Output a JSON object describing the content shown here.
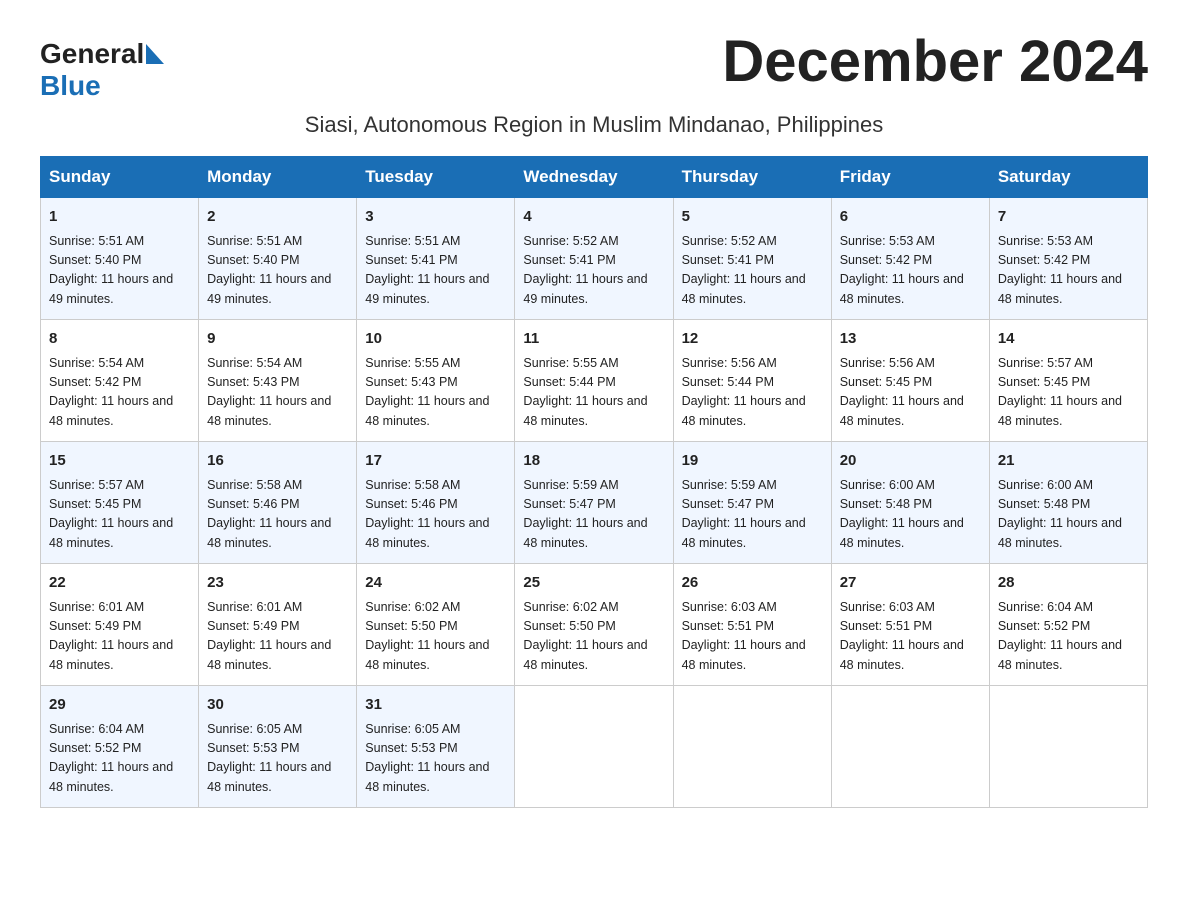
{
  "header": {
    "logo_general": "General",
    "logo_blue": "Blue",
    "month_title": "December 2024",
    "subtitle": "Siasi, Autonomous Region in Muslim Mindanao, Philippines"
  },
  "days_of_week": [
    "Sunday",
    "Monday",
    "Tuesday",
    "Wednesday",
    "Thursday",
    "Friday",
    "Saturday"
  ],
  "weeks": [
    [
      {
        "num": "1",
        "sunrise": "5:51 AM",
        "sunset": "5:40 PM",
        "daylight": "11 hours and 49 minutes."
      },
      {
        "num": "2",
        "sunrise": "5:51 AM",
        "sunset": "5:40 PM",
        "daylight": "11 hours and 49 minutes."
      },
      {
        "num": "3",
        "sunrise": "5:51 AM",
        "sunset": "5:41 PM",
        "daylight": "11 hours and 49 minutes."
      },
      {
        "num": "4",
        "sunrise": "5:52 AM",
        "sunset": "5:41 PM",
        "daylight": "11 hours and 49 minutes."
      },
      {
        "num": "5",
        "sunrise": "5:52 AM",
        "sunset": "5:41 PM",
        "daylight": "11 hours and 48 minutes."
      },
      {
        "num": "6",
        "sunrise": "5:53 AM",
        "sunset": "5:42 PM",
        "daylight": "11 hours and 48 minutes."
      },
      {
        "num": "7",
        "sunrise": "5:53 AM",
        "sunset": "5:42 PM",
        "daylight": "11 hours and 48 minutes."
      }
    ],
    [
      {
        "num": "8",
        "sunrise": "5:54 AM",
        "sunset": "5:42 PM",
        "daylight": "11 hours and 48 minutes."
      },
      {
        "num": "9",
        "sunrise": "5:54 AM",
        "sunset": "5:43 PM",
        "daylight": "11 hours and 48 minutes."
      },
      {
        "num": "10",
        "sunrise": "5:55 AM",
        "sunset": "5:43 PM",
        "daylight": "11 hours and 48 minutes."
      },
      {
        "num": "11",
        "sunrise": "5:55 AM",
        "sunset": "5:44 PM",
        "daylight": "11 hours and 48 minutes."
      },
      {
        "num": "12",
        "sunrise": "5:56 AM",
        "sunset": "5:44 PM",
        "daylight": "11 hours and 48 minutes."
      },
      {
        "num": "13",
        "sunrise": "5:56 AM",
        "sunset": "5:45 PM",
        "daylight": "11 hours and 48 minutes."
      },
      {
        "num": "14",
        "sunrise": "5:57 AM",
        "sunset": "5:45 PM",
        "daylight": "11 hours and 48 minutes."
      }
    ],
    [
      {
        "num": "15",
        "sunrise": "5:57 AM",
        "sunset": "5:45 PM",
        "daylight": "11 hours and 48 minutes."
      },
      {
        "num": "16",
        "sunrise": "5:58 AM",
        "sunset": "5:46 PM",
        "daylight": "11 hours and 48 minutes."
      },
      {
        "num": "17",
        "sunrise": "5:58 AM",
        "sunset": "5:46 PM",
        "daylight": "11 hours and 48 minutes."
      },
      {
        "num": "18",
        "sunrise": "5:59 AM",
        "sunset": "5:47 PM",
        "daylight": "11 hours and 48 minutes."
      },
      {
        "num": "19",
        "sunrise": "5:59 AM",
        "sunset": "5:47 PM",
        "daylight": "11 hours and 48 minutes."
      },
      {
        "num": "20",
        "sunrise": "6:00 AM",
        "sunset": "5:48 PM",
        "daylight": "11 hours and 48 minutes."
      },
      {
        "num": "21",
        "sunrise": "6:00 AM",
        "sunset": "5:48 PM",
        "daylight": "11 hours and 48 minutes."
      }
    ],
    [
      {
        "num": "22",
        "sunrise": "6:01 AM",
        "sunset": "5:49 PM",
        "daylight": "11 hours and 48 minutes."
      },
      {
        "num": "23",
        "sunrise": "6:01 AM",
        "sunset": "5:49 PM",
        "daylight": "11 hours and 48 minutes."
      },
      {
        "num": "24",
        "sunrise": "6:02 AM",
        "sunset": "5:50 PM",
        "daylight": "11 hours and 48 minutes."
      },
      {
        "num": "25",
        "sunrise": "6:02 AM",
        "sunset": "5:50 PM",
        "daylight": "11 hours and 48 minutes."
      },
      {
        "num": "26",
        "sunrise": "6:03 AM",
        "sunset": "5:51 PM",
        "daylight": "11 hours and 48 minutes."
      },
      {
        "num": "27",
        "sunrise": "6:03 AM",
        "sunset": "5:51 PM",
        "daylight": "11 hours and 48 minutes."
      },
      {
        "num": "28",
        "sunrise": "6:04 AM",
        "sunset": "5:52 PM",
        "daylight": "11 hours and 48 minutes."
      }
    ],
    [
      {
        "num": "29",
        "sunrise": "6:04 AM",
        "sunset": "5:52 PM",
        "daylight": "11 hours and 48 minutes."
      },
      {
        "num": "30",
        "sunrise": "6:05 AM",
        "sunset": "5:53 PM",
        "daylight": "11 hours and 48 minutes."
      },
      {
        "num": "31",
        "sunrise": "6:05 AM",
        "sunset": "5:53 PM",
        "daylight": "11 hours and 48 minutes."
      },
      null,
      null,
      null,
      null
    ]
  ]
}
